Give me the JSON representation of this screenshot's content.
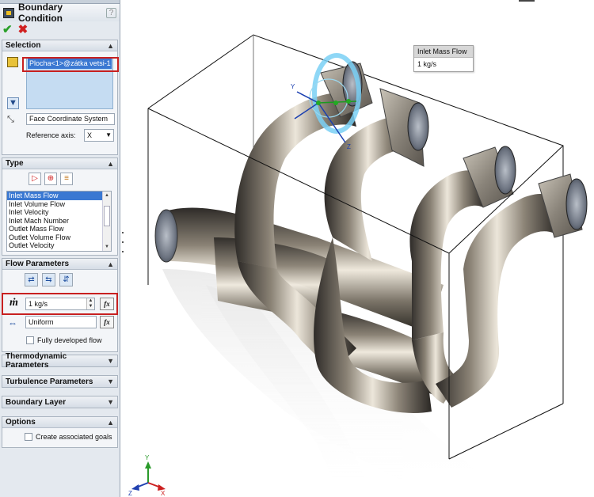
{
  "property_manager": {
    "title": "Boundary Condition",
    "help": "?",
    "ok_symbol": "✔",
    "cancel_symbol": "✖"
  },
  "selection": {
    "heading": "Selection",
    "selected_face": "Plocha<1>@zátka vetsi-1",
    "coordinate_system": "Face Coordinate System",
    "reference_axis_label": "Reference axis:",
    "reference_axis_value": "X"
  },
  "type": {
    "heading": "Type",
    "items": [
      "Inlet Mass Flow",
      "Inlet Volume Flow",
      "Inlet Velocity",
      "Inlet Mach Number",
      "Outlet Mass Flow",
      "Outlet Volume Flow",
      "Outlet Velocity"
    ],
    "selected_index": 0
  },
  "flow_parameters": {
    "heading": "Flow Parameters",
    "mass_flow_symbol": "ṁ",
    "mass_flow_value": "1 kg/s",
    "distribution_value": "Uniform",
    "fx_label": "fx",
    "fully_developed_label": "Fully developed flow",
    "fully_developed_checked": false
  },
  "collapsed_groups": {
    "thermodynamic": "Thermodynamic Parameters",
    "turbulence": "Turbulence Parameters",
    "boundary_layer": "Boundary Layer"
  },
  "options": {
    "heading": "Options",
    "create_goals_label": "Create associated goals",
    "create_goals_checked": false
  },
  "viewport": {
    "callout_title": "Inlet Mass Flow",
    "callout_value": "1 kg/s",
    "triad_axes": [
      "X",
      "Y",
      "Z"
    ]
  },
  "colors": {
    "selection_blue": "#3a78d2",
    "highlight_red": "#c82020",
    "panel_bg": "#e4e9ef"
  }
}
